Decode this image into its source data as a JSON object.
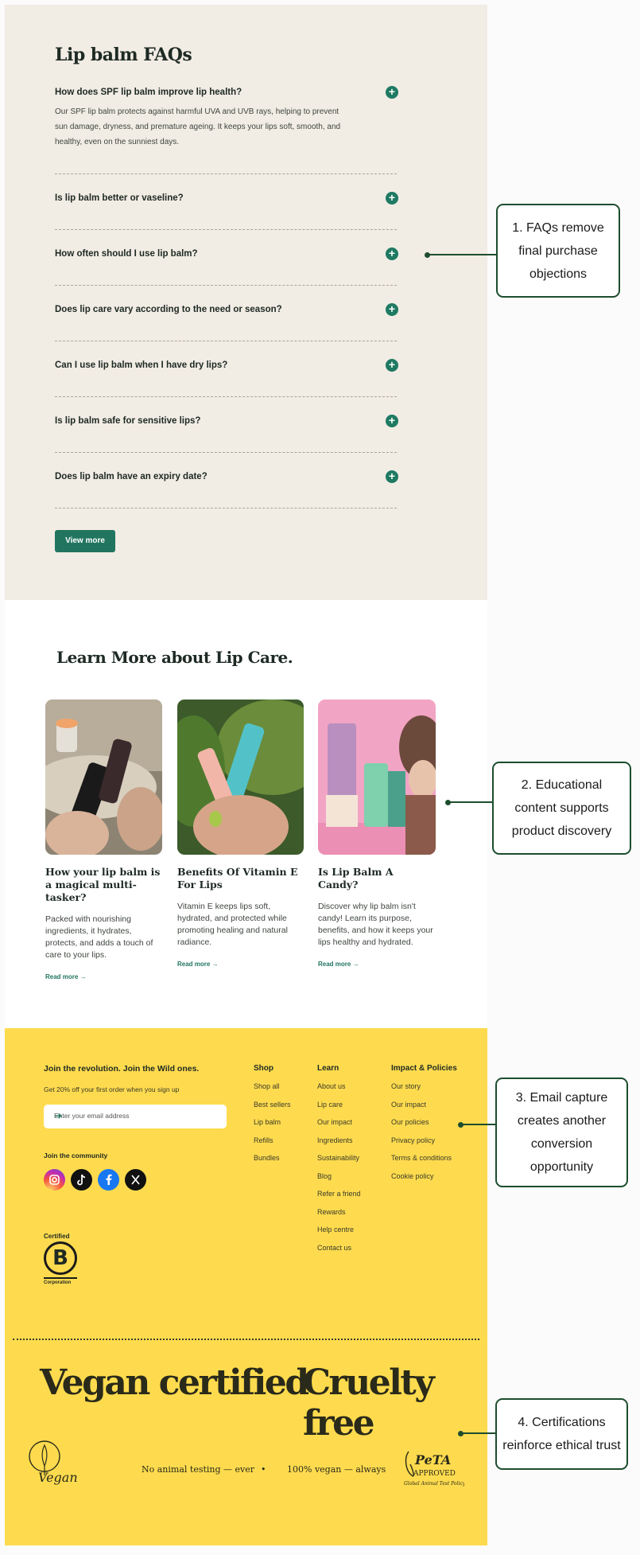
{
  "faq": {
    "title": "Lip balm FAQs",
    "items": [
      {
        "q": "How does SPF lip balm improve lip health?",
        "a": "Our SPF lip balm protects against harmful UVA and UVB rays, helping to prevent sun damage, dryness, and premature ageing. It keeps your lips soft, smooth, and healthy, even on the sunniest days."
      },
      {
        "q": "Is lip balm better or vaseline?"
      },
      {
        "q": "How often should I use lip balm?"
      },
      {
        "q": "Does lip care vary according to the need or season?"
      },
      {
        "q": "Can I use lip balm when I have dry lips?"
      },
      {
        "q": "Is lip balm safe for sensitive lips?"
      },
      {
        "q": "Does lip balm have an expiry date?"
      }
    ],
    "toggle_icon": "+",
    "view_more": "View more"
  },
  "learn": {
    "title": "Learn More about Lip Care.",
    "cards": [
      {
        "title": "How your lip balm is a magical multi-tasker?",
        "desc": "Packed with nourishing ingredients, it hydrates, protects, and adds a touch of care to your lips.",
        "link": "Read more →"
      },
      {
        "title": "Benefits Of Vitamin E For Lips",
        "desc": "Vitamin E keeps lips soft, hydrated, and protected while promoting healing and natural radiance.",
        "link": "Read more →"
      },
      {
        "title": "Is Lip Balm A Candy?",
        "desc": "Discover why lip balm isn't candy! Learn its purpose, benefits, and how it keeps your lips healthy and hydrated.",
        "link": "Read more →"
      }
    ]
  },
  "footer": {
    "heading": "Join the revolution. Join the Wild ones.",
    "sub": "Get 20% off your first order when you sign up",
    "email_placeholder": "Enter your email address",
    "community": "Join the community",
    "bcorp": {
      "top": "Certified",
      "letter": "B",
      "bottom": "Corporation"
    },
    "columns": [
      {
        "heading": "Shop",
        "links": [
          "Shop all",
          "Best sellers",
          "Lip balm",
          "Refills",
          "Bundles"
        ]
      },
      {
        "heading": "Learn",
        "links": [
          "About us",
          "Lip care",
          "Our impact",
          "Ingredients",
          "Sustainability",
          "Blog",
          "Refer a friend",
          "Rewards",
          "Help centre",
          "Contact us"
        ]
      },
      {
        "heading": "Impact & Policies",
        "links": [
          "Our story",
          "Our impact",
          "Our policies",
          "Privacy policy",
          "Terms & conditions",
          "Cookie policy"
        ]
      }
    ],
    "big_left": "Vegan certified",
    "big_right": "Cruelty free",
    "strap_left": "No animal testing — ever",
    "strap_right": "100% vegan — always"
  },
  "annotations": [
    "1. FAQs remove final purchase objections",
    "2. Educational content supports product discovery",
    "3. Email capture creates another conversion opportunity",
    "4. Certifications reinforce ethical trust"
  ],
  "colors": {
    "accent": "#21755f",
    "faq_bg": "#f1ece4",
    "footer_bg": "#fedb4e",
    "annotation": "#1d4d2e"
  }
}
